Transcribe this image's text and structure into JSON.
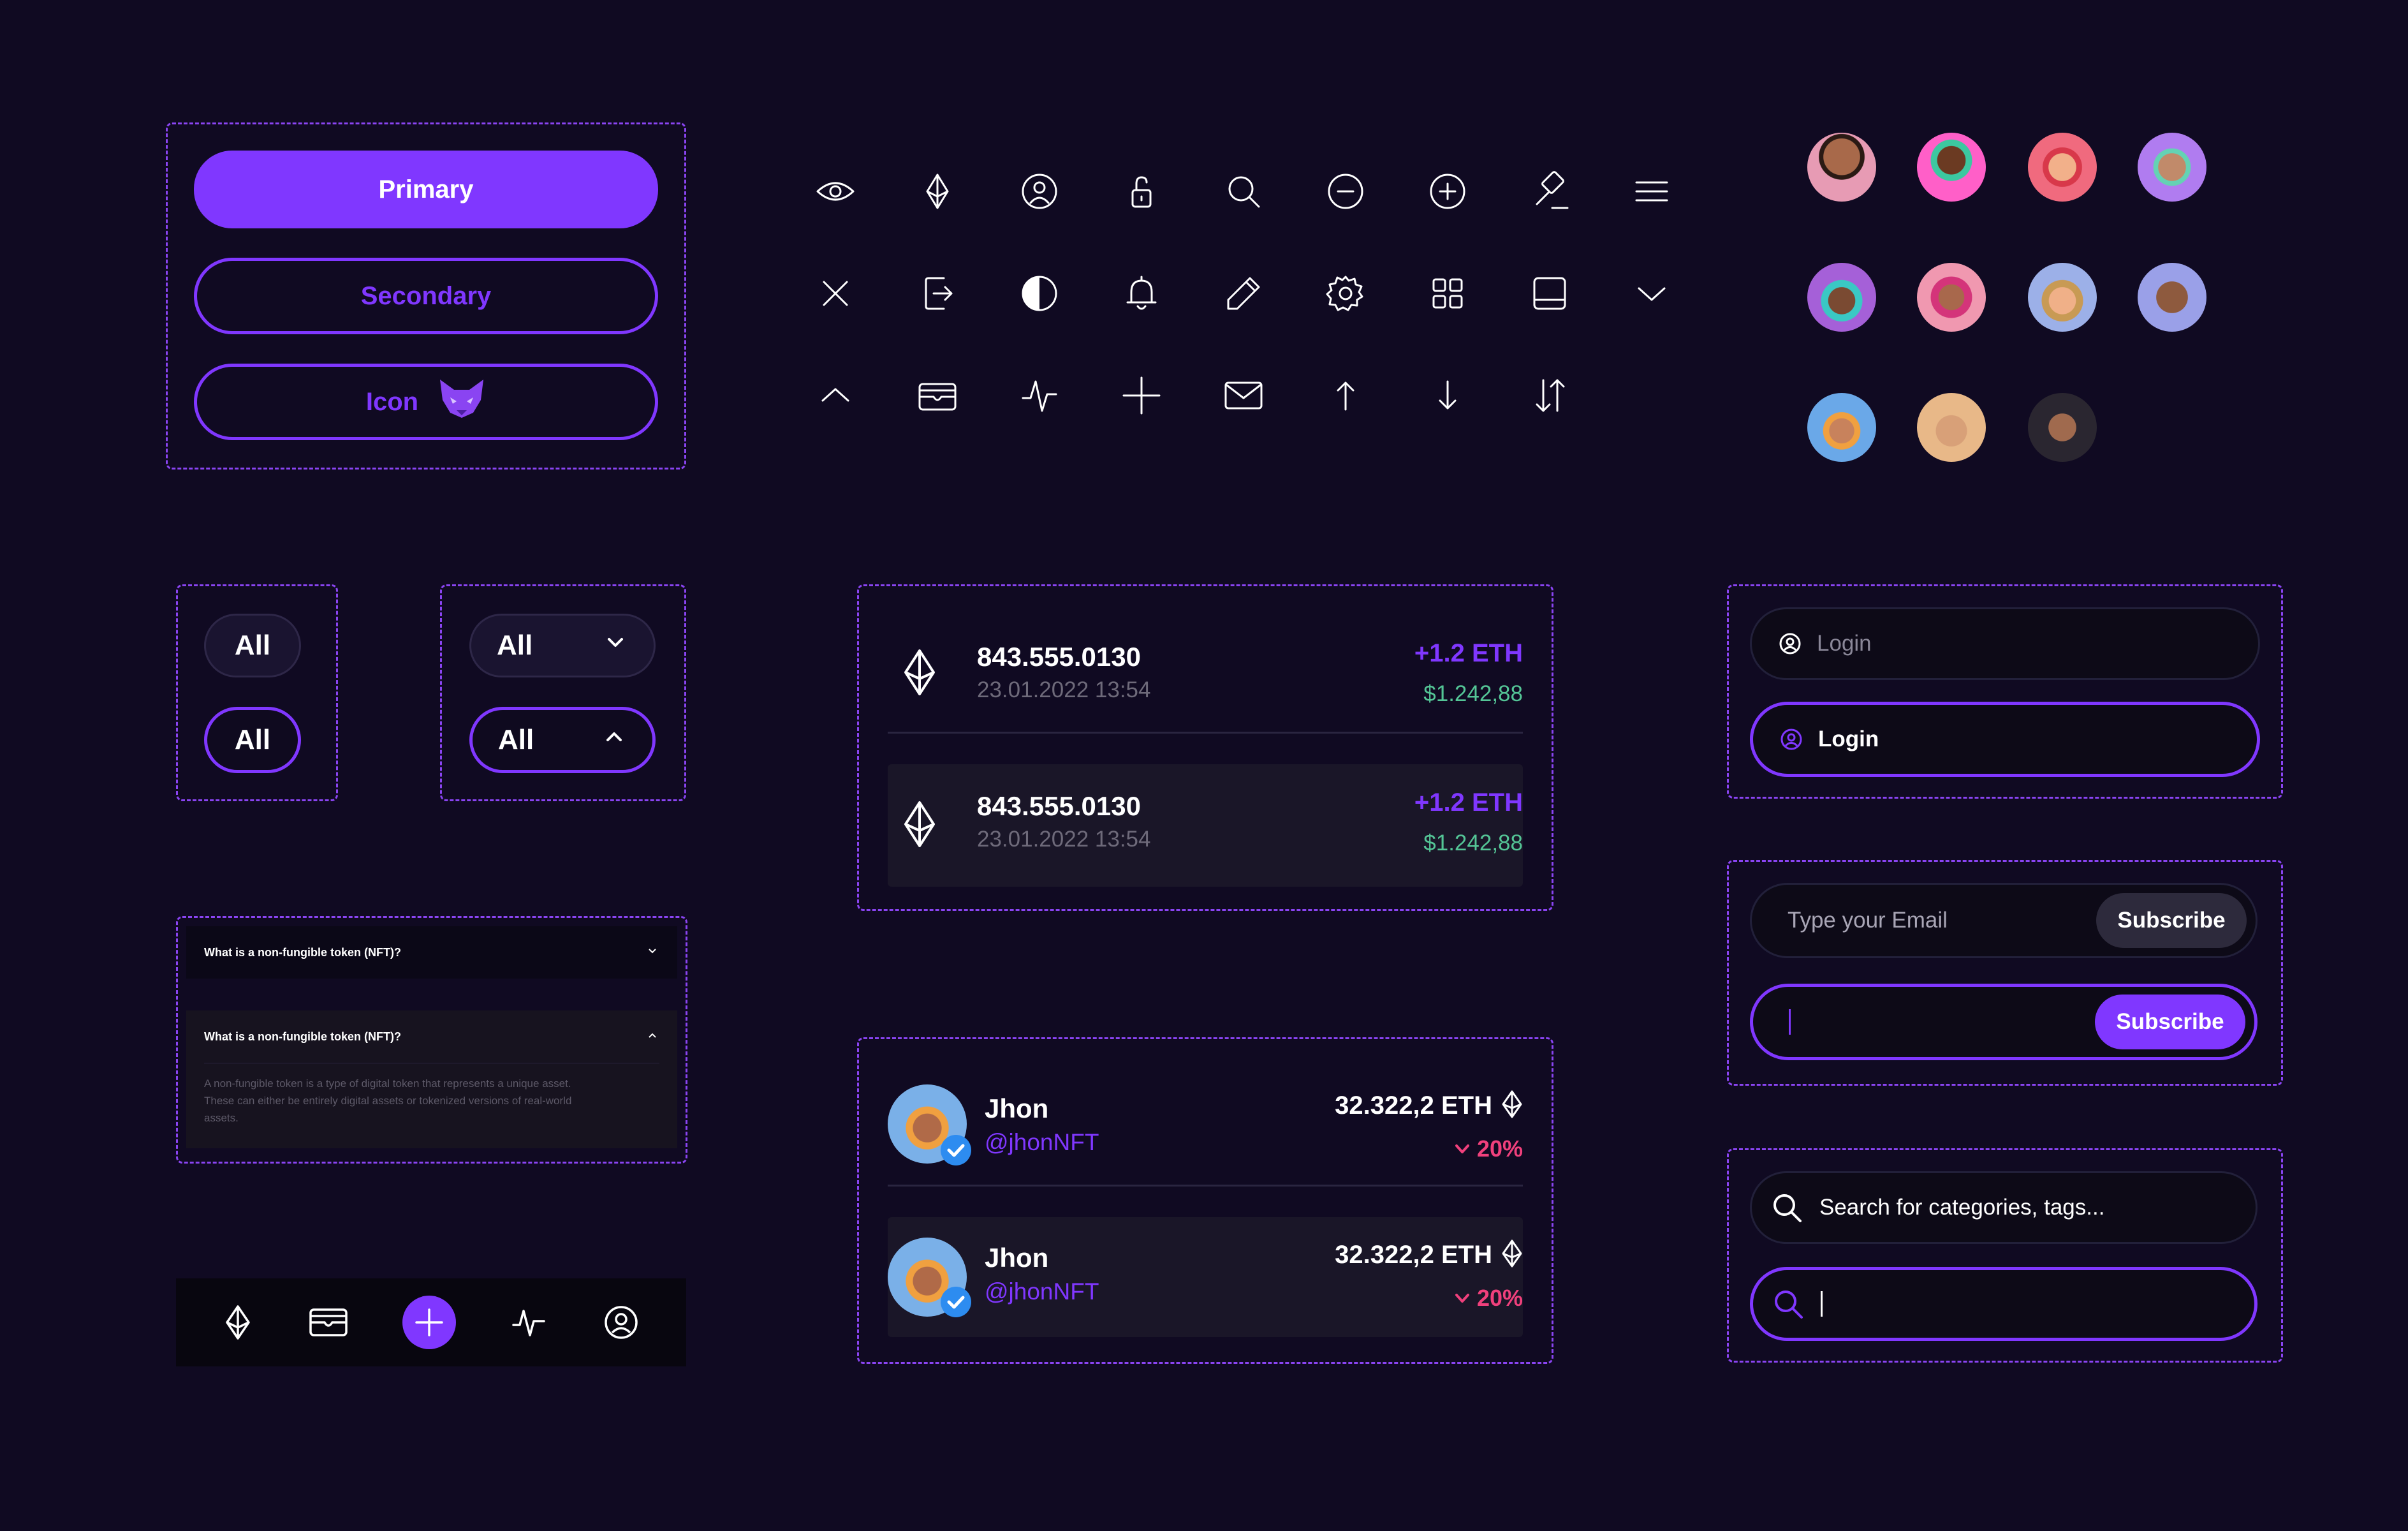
{
  "buttons": {
    "primary_label": "Primary",
    "secondary_label": "Secondary",
    "icon_label": "Icon"
  },
  "icons": [
    "eye-icon",
    "ethereum-icon",
    "user-circle-icon",
    "unlock-icon",
    "search-icon",
    "minus-circle-icon",
    "plus-circle-icon",
    "gavel-icon",
    "menu-icon",
    "close-icon",
    "logout-icon",
    "contrast-icon",
    "bell-icon",
    "pen-icon",
    "gear-icon",
    "grid-icon",
    "tablet-icon",
    "chevron-down-icon",
    "chevron-up-icon",
    "wallet-icon",
    "activity-icon",
    "plus-icon",
    "mail-icon",
    "arrow-up-icon",
    "arrow-down-icon",
    "sort-arrows-icon"
  ],
  "filters": {
    "chip_label": "All",
    "dropdown_label": "All"
  },
  "transactions": [
    {
      "amount": "843.555.0130",
      "date": "23.01.2022 13:54",
      "eth_change": "+1.2 ETH",
      "usd": "$1.242,88"
    },
    {
      "amount": "843.555.0130",
      "date": "23.01.2022 13:54",
      "eth_change": "+1.2 ETH",
      "usd": "$1.242,88"
    }
  ],
  "login": {
    "placeholder": "Login",
    "active_value": "Login"
  },
  "subscribe": {
    "placeholder": "Type your Email",
    "button_label": "Subscribe"
  },
  "search": {
    "placeholder": "Search for categories, tags..."
  },
  "faq": {
    "question": "What is a non-fungible token (NFT)?",
    "answer_line1": "A non-fungible token is a type of digital token that represents a unique asset.",
    "answer_line2": "These can either be entirely digital assets or tokenized versions of real-world",
    "answer_line3": "assets."
  },
  "users": [
    {
      "name": "Jhon",
      "handle": "@jhonNFT",
      "eth": "32.322,2 ETH",
      "change": "20%"
    },
    {
      "name": "Jhon",
      "handle": "@jhonNFT",
      "eth": "32.322,2 ETH",
      "change": "20%"
    }
  ],
  "colors": {
    "background": "#100a22",
    "accent": "#8037ff",
    "positive": "#54c596",
    "negative": "#f0407c"
  }
}
